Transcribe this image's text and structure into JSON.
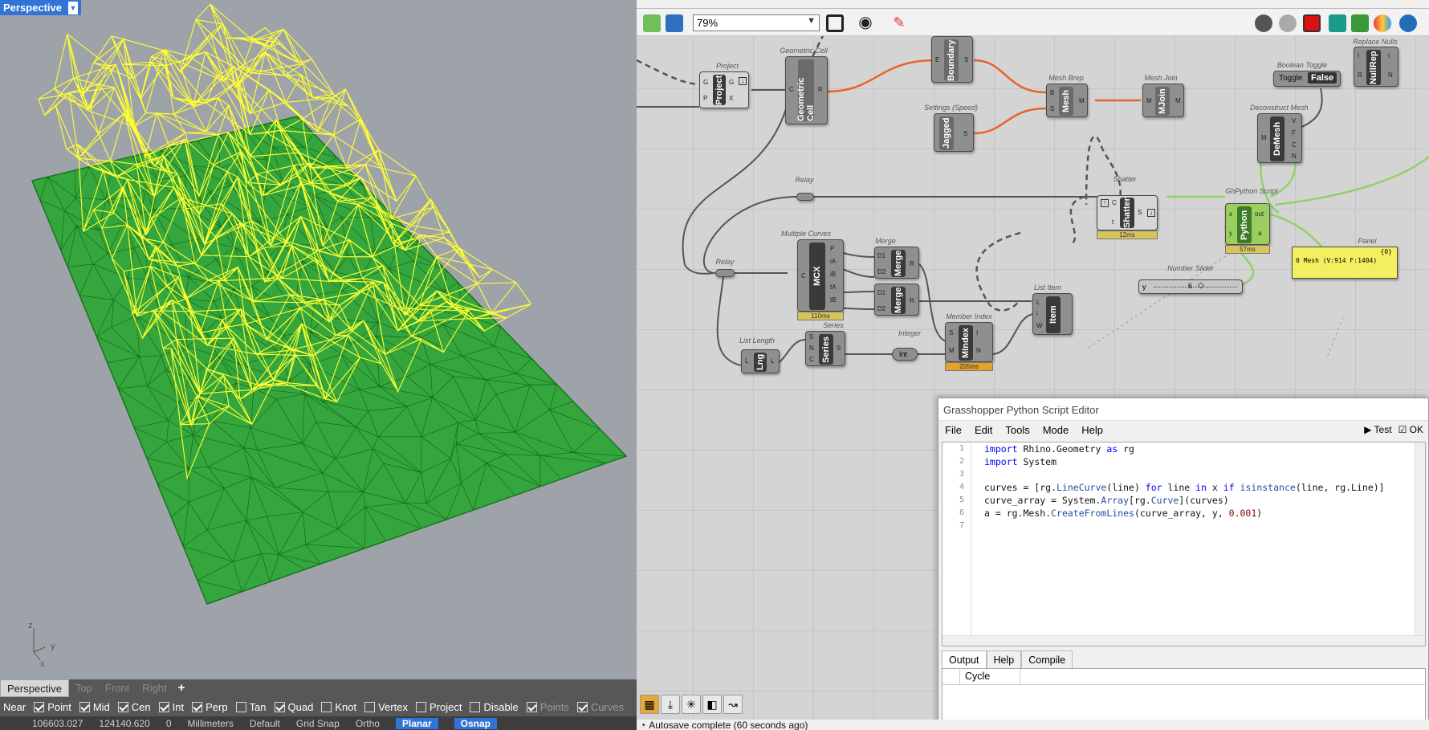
{
  "viewport": {
    "title": "Perspective",
    "axes": {
      "z": "z",
      "y": "y",
      "x": "x"
    },
    "tabs": [
      "Perspective",
      "Top",
      "Front",
      "Right"
    ],
    "add_tab": "+",
    "colors": {
      "mesh": "#22a72a",
      "wire": "#ffff33",
      "background": "#9ea3aa"
    }
  },
  "osnap": {
    "items": [
      {
        "label": "Near",
        "checked": false,
        "plain": true
      },
      {
        "label": "Point",
        "checked": true
      },
      {
        "label": "Mid",
        "checked": true
      },
      {
        "label": "Cen",
        "checked": true
      },
      {
        "label": "Int",
        "checked": true
      },
      {
        "label": "Perp",
        "checked": true
      },
      {
        "label": "Tan",
        "checked": false
      },
      {
        "label": "Quad",
        "checked": true
      },
      {
        "label": "Knot",
        "checked": false
      },
      {
        "label": "Vertex",
        "checked": false
      },
      {
        "label": "Project",
        "checked": false
      },
      {
        "label": "Disable",
        "checked": false
      },
      {
        "label": "Points",
        "checked": true
      },
      {
        "label": "Curves",
        "checked": true
      }
    ]
  },
  "status": {
    "cplane": "",
    "x": "106603.027",
    "y": "124140.620",
    "z": "0",
    "units": "Millimeters",
    "layer": "Default",
    "grid_snap": "Grid Snap",
    "ortho": "Ortho",
    "planar": "Planar",
    "osnap": "Osnap"
  },
  "gh": {
    "zoom": "79%",
    "components": {
      "project": {
        "title": "Project",
        "nick": "Project",
        "in": [
          "G",
          "P"
        ],
        "out": [
          "G",
          "X"
        ]
      },
      "geocell": {
        "title": "Geometric Cell",
        "nick": "Geometric Cell",
        "in": [
          "C"
        ],
        "out": [
          "R"
        ]
      },
      "boundary": {
        "title": "",
        "nick": "Boundary",
        "in": [
          "E"
        ],
        "out": [
          "S"
        ]
      },
      "settings": {
        "title": "Settings (Speed)",
        "nick": "Jagged",
        "out": [
          "S"
        ]
      },
      "meshbrep": {
        "title": "Mesh Brep",
        "nick": "Mesh",
        "in": [
          "B",
          "S"
        ],
        "out": [
          "M"
        ]
      },
      "meshjoin": {
        "title": "Mesh Join",
        "nick": "MJoin",
        "in": [
          "M"
        ],
        "out": [
          "M"
        ]
      },
      "toggle": {
        "title": "Boolean Toggle",
        "label": "Toggle",
        "value": "False"
      },
      "nullrep": {
        "title": "Replace Nulls",
        "nick": "NullRep",
        "in": [
          "I",
          "R"
        ],
        "out": [
          "I",
          "N"
        ]
      },
      "demesh": {
        "title": "Deconstruct Mesh",
        "nick": "DeMesh",
        "in": [
          "M"
        ],
        "out": [
          "V",
          "F",
          "C",
          "N"
        ]
      },
      "relay1": {
        "title": "Relay"
      },
      "relay2": {
        "title": "Relay"
      },
      "shatter": {
        "title": "Shatter",
        "nick": "Shatter",
        "in": [
          "C",
          "t"
        ],
        "out": [
          "S"
        ],
        "time": "12ms"
      },
      "python": {
        "title": "GhPython Script",
        "nick": "Python",
        "in": [
          "x",
          "y"
        ],
        "out": [
          "out",
          "a"
        ],
        "time": "57ms"
      },
      "panel": {
        "title": "Panel",
        "content": "0 Mesh (V:914 F:1404)",
        "index": "{0}"
      },
      "slider": {
        "title": "Number Slider",
        "label": "y",
        "value": "6"
      },
      "mcx": {
        "title": "Multiple Curves",
        "nick": "MCX",
        "in": [
          "C"
        ],
        "out": [
          "P",
          "iA",
          "iB",
          "tA",
          "tB"
        ],
        "time": "110ms"
      },
      "merge1": {
        "title": "Merge",
        "nick": "Merge",
        "in": [
          "D1",
          "D2"
        ],
        "out": [
          "R"
        ]
      },
      "merge2": {
        "nick": "Merge",
        "in": [
          "D1",
          "D2"
        ],
        "out": [
          "R"
        ]
      },
      "listitem": {
        "title": "List Item",
        "nick": "Item",
        "in": [
          "L",
          "i",
          "W"
        ]
      },
      "mindex": {
        "title": "Member Index",
        "nick": "MIndex",
        "in": [
          "S",
          "M"
        ],
        "out": [
          "I",
          "N"
        ],
        "time": "205ms"
      },
      "series": {
        "title": "Series",
        "nick": "Series",
        "in": [
          "S",
          "N",
          "C"
        ],
        "out": [
          "S"
        ]
      },
      "listlen": {
        "title": "List Length",
        "nick": "Lng",
        "in": [
          "L"
        ],
        "out": [
          "L"
        ]
      },
      "integer": {
        "title": "Integer",
        "nick": "Int"
      }
    },
    "status": "Autosave complete (60 seconds ago)"
  },
  "editor": {
    "title": "Grasshopper Python Script Editor",
    "menu": [
      "File",
      "Edit",
      "Tools",
      "Mode",
      "Help"
    ],
    "test": "Test",
    "ok": "OK",
    "code": [
      "import Rhino.Geometry as rg",
      "import System",
      "",
      "curves = [rg.LineCurve(line) for line in x if isinstance(line, rg.Line)]",
      "curve_array = System.Array[rg.Curve](curves)",
      "a = rg.Mesh.CreateFromLines(curve_array, y, 0.001)",
      ""
    ],
    "line_numbers": [
      "1",
      "2",
      "3",
      "4",
      "5",
      "6",
      "7"
    ],
    "tabs": [
      "Output",
      "Help",
      "Compile"
    ],
    "output_header": "Cycle"
  }
}
